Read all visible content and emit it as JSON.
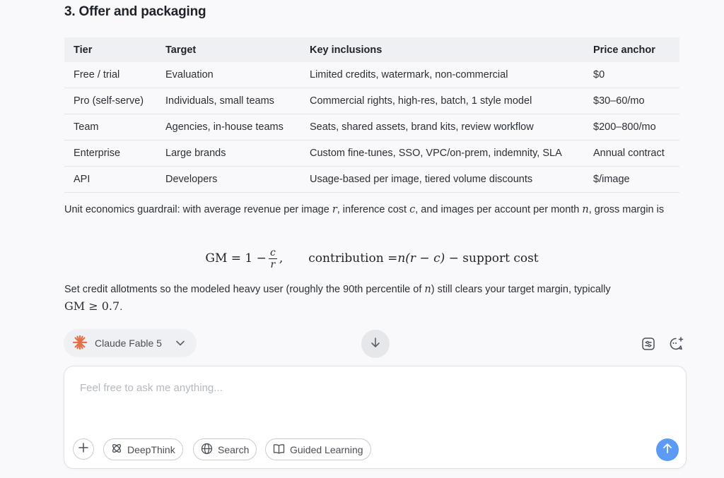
{
  "section": {
    "title": "3. Offer and packaging"
  },
  "table": {
    "headers": [
      "Tier",
      "Target",
      "Key inclusions",
      "Price anchor"
    ],
    "rows": [
      [
        "Free / trial",
        "Evaluation",
        "Limited credits, watermark, non-commercial",
        "$0"
      ],
      [
        "Pro (self-serve)",
        "Individuals, small teams",
        "Commercial rights, high-res, batch, 1 style model",
        "$30–60/mo"
      ],
      [
        "Team",
        "Agencies, in-house teams",
        "Seats, shared assets, brand kits, review workflow",
        "$200–800/mo"
      ],
      [
        "Enterprise",
        "Large brands",
        "Custom fine-tunes, SSO, VPC/on-prem, indemnity, SLA",
        "Annual contract"
      ],
      [
        "API",
        "Developers",
        "Usage-based per image, tiered volume discounts",
        "$/image"
      ]
    ]
  },
  "paragraph1": {
    "part1": "Unit economics guardrail: with average revenue per image ",
    "var_r": "r",
    "part2": ", inference cost ",
    "var_c": "c",
    "part3": ", and images per account per month ",
    "var_n": "n",
    "part4": ", gross margin is"
  },
  "formula": {
    "gm_lhs": "GM = 1 − ",
    "frac_num": "c",
    "frac_den": "r",
    "comma": ",",
    "contrib_lhs": "contribution = ",
    "contrib_rhs_n": "n",
    "contrib_rhs_paren": "(r − c)",
    "contrib_rhs_tail": " − support cost"
  },
  "paragraph2": {
    "part1": "Set credit allotments so the modeled heavy user (roughly the 90th percentile of ",
    "var_n": "n",
    "part2": ") still clears your target margin, typically",
    "math": "GM ≥ 0.7",
    "tail": "."
  },
  "model": {
    "name": "Claude Fable 5"
  },
  "composer": {
    "placeholder": "Feel free to ask me anything...",
    "chips": {
      "deepthink": "DeepThink",
      "search": "Search",
      "guided": "Guided Learning"
    }
  },
  "colors": {
    "accent": "#5b9bf5",
    "brand_star": "#e2704a"
  },
  "icons": [
    "chevron-down-icon",
    "arrow-down-icon",
    "settings-sliders-icon",
    "new-chat-icon",
    "plus-icon",
    "atom-icon",
    "globe-icon",
    "book-icon",
    "arrow-up-icon",
    "star-burst-icon"
  ]
}
